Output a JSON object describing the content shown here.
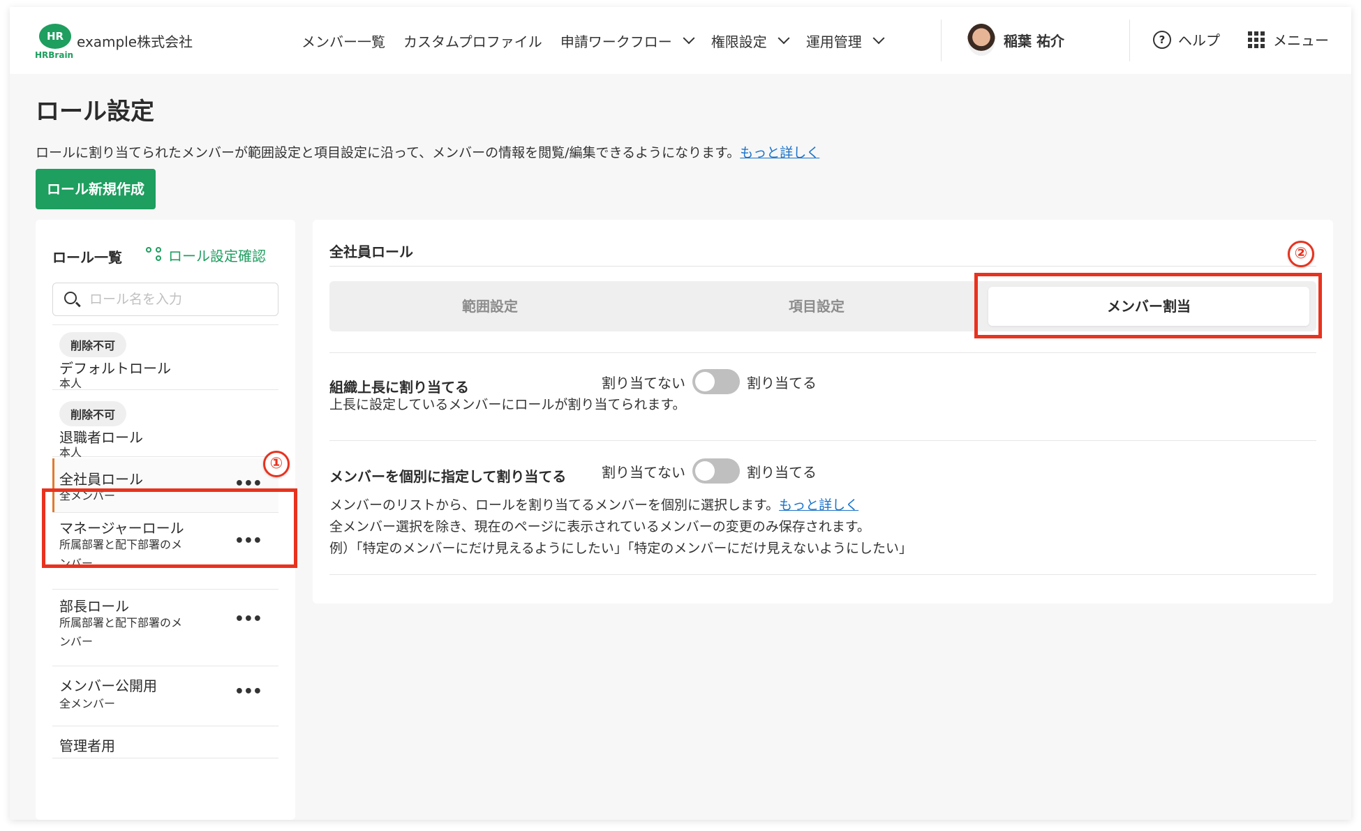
{
  "header": {
    "logo_mark": "HR",
    "logo_text": "HRBrain",
    "company": "example株式会社",
    "nav": [
      {
        "label": "メンバー一覧"
      },
      {
        "label": "カスタムプロファイル"
      },
      {
        "label": "申請ワークフロー"
      },
      {
        "label": "権限設定"
      },
      {
        "label": "運用管理"
      }
    ],
    "user_name": "稲葉 祐介",
    "help_label": "ヘルプ",
    "menu_label": "メニュー"
  },
  "page": {
    "title": "ロール設定",
    "description": "ロールに割り当てられたメンバーが範囲設定と項目設定に沿って、メンバーの情報を閲覧/編集できるようになります。",
    "more_link": "もっと詳しく",
    "new_button": "ロール新規作成"
  },
  "sidebar": {
    "heading": "ロール一覧",
    "confirm_link": "ロール設定確認",
    "search_placeholder": "ロール名を入力",
    "roles": [
      {
        "badge": "削除不可",
        "name": "デフォルトロール",
        "sub": "本人"
      },
      {
        "badge": "削除不可",
        "name": "退職者ロール",
        "sub": "本人"
      },
      {
        "name": "全社員ロール",
        "sub": "全メンバー",
        "menu": "•••"
      },
      {
        "name": "マネージャーロール",
        "sub": "所属部署と配下部署のメンバー",
        "menu": "•••"
      },
      {
        "name": "部長ロール",
        "sub": "所属部署と配下部署のメンバー",
        "menu": "•••"
      },
      {
        "name": "メンバー公開用",
        "sub": "全メンバー",
        "menu": "•••"
      },
      {
        "name": "管理者用"
      }
    ]
  },
  "detail": {
    "title": "全社員ロール",
    "tabs": [
      {
        "label": "範囲設定"
      },
      {
        "label": "項目設定"
      },
      {
        "label": "メンバー割当"
      }
    ],
    "settings": [
      {
        "label": "組織上長に割り当てる",
        "off_label": "割り当てない",
        "on_label": "割り当てる",
        "enabled": false,
        "desc": [
          "上長に設定しているメンバーにロールが割り当てられます。"
        ]
      },
      {
        "label": "メンバーを個別に指定して割り当てる",
        "off_label": "割り当てない",
        "on_label": "割り当てる",
        "enabled": false,
        "desc": [
          "メンバーのリストから、ロールを割り当てるメンバーを個別に選択します。",
          "全メンバー選択を除き、現在のページに表示されているメンバーの変更のみ保存されます。",
          "例）「特定のメンバーにだけ見えるようにしたい」「特定のメンバーにだけ見えないようにしたい」"
        ],
        "more_link": "もっと詳しく"
      }
    ]
  },
  "annotations": {
    "marker_1": "①",
    "marker_2": "②",
    "highlight_color": "#e8321e"
  },
  "colors": {
    "brand": "#1e9e5f",
    "link": "#1a73c9",
    "active_accent": "#e07a2e"
  }
}
